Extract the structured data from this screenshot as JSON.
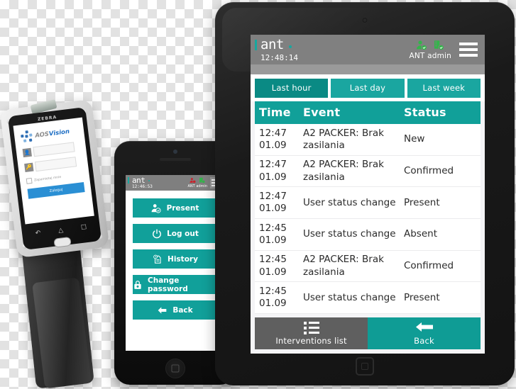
{
  "colors": {
    "teal": "#11a09a",
    "teal_dark": "#0a8a84",
    "teal_light": "#1aa6a0",
    "grey_bar": "#808080",
    "grey_button": "#5f5f5f",
    "status_green": "#33b54a",
    "status_red": "#c9222b",
    "zebra_blue": "#2a8fd4"
  },
  "tablet": {
    "topbar": {
      "logo_word": "ant",
      "clock": "12:48:14",
      "user_label": "ANT admin",
      "user_icon": "user-check-icon",
      "server_icon": "server-check-icon",
      "menu_icon": "hamburger-menu-icon"
    },
    "range_tabs": [
      {
        "label": "Last hour",
        "active": true
      },
      {
        "label": "Last day",
        "active": false
      },
      {
        "label": "Last week",
        "active": false
      }
    ],
    "table": {
      "headers": [
        "Time",
        "Event",
        "Status"
      ],
      "rows": [
        {
          "time": "12:47\n01.09",
          "event": "A2 PACKER: Brak zasilania",
          "status": "New"
        },
        {
          "time": "12:47\n01.09",
          "event": "A2 PACKER: Brak zasilania",
          "status": "Confirmed"
        },
        {
          "time": "12:47\n01.09",
          "event": "User status change",
          "status": "Present"
        },
        {
          "time": "12:45\n01.09",
          "event": "User status change",
          "status": "Absent"
        },
        {
          "time": "12:45\n01.09",
          "event": "A2 PACKER: Brak zasilania",
          "status": "Confirmed"
        },
        {
          "time": "12:45\n01.09",
          "event": "User status change",
          "status": "Present"
        }
      ]
    },
    "bottom": {
      "interventions_label": "Interventions list",
      "interventions_icon": "list-icon",
      "back_label": "Back",
      "back_icon": "arrow-left-icon"
    }
  },
  "phone": {
    "topbar": {
      "logo_word": "ant",
      "clock": "12:46:53",
      "user_label": "ANT admin",
      "user_icon": "user-alert-icon",
      "server_icon": "server-check-icon",
      "menu_icon": "hamburger-menu-icon"
    },
    "menu": [
      {
        "label": "Present",
        "icon": "user-check-icon"
      },
      {
        "label": "Log out",
        "icon": "power-icon"
      },
      {
        "label": "History",
        "icon": "history-document-icon"
      },
      {
        "label": "Change password",
        "icon": "lock-icon"
      },
      {
        "label": "Back",
        "icon": "arrow-left-icon"
      }
    ]
  },
  "handheld": {
    "brand": "ZEBRA",
    "app_logo": {
      "primary": "AOS",
      "secondary": "Vision"
    },
    "login": {
      "user_icon": "user-icon",
      "password_icon": "key-icon",
      "user_value": "",
      "password_value": "",
      "remember_label": "Zapamietaj mnie",
      "submit_label": "Zaloguj"
    },
    "nav": {
      "back_icon": "android-back-icon",
      "home_icon": "android-home-icon",
      "recents_icon": "android-recents-icon"
    }
  }
}
